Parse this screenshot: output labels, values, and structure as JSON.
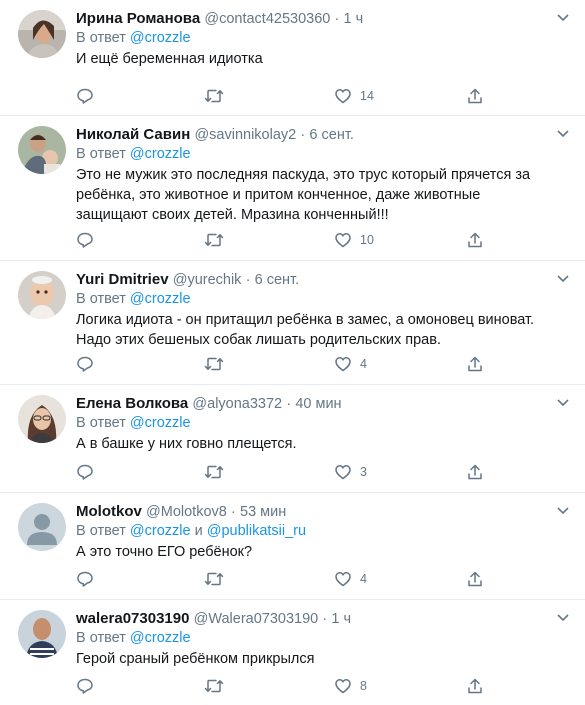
{
  "tweets": [
    {
      "name": "Ирина Романова",
      "handle": "@contact42530360",
      "sep": "·",
      "time": "1 ч",
      "reply_prefix": "В ответ",
      "reply_to": "@crozzle",
      "reply_and": "",
      "reply_to2": "",
      "text": "И ещё беременная идиотка",
      "likes": "14",
      "avatar_icon": "woman-photo-avatar"
    },
    {
      "name": "Николай Савин",
      "handle": "@savinnikolay2",
      "sep": "·",
      "time": "6 сент.",
      "reply_prefix": "В ответ",
      "reply_to": "@crozzle",
      "reply_and": "",
      "reply_to2": "",
      "text": "Это не мужик это последняя паскуда, это трус который прячется за ребёнка, это животное и притом конченное, даже животные защищают своих детей. Мразина конченный!!!",
      "likes": "10",
      "avatar_icon": "man-with-child-avatar"
    },
    {
      "name": "Yuri Dmitriev",
      "handle": "@yurechik",
      "sep": "·",
      "time": "6 сент.",
      "reply_prefix": "В ответ",
      "reply_to": "@crozzle",
      "reply_and": "",
      "reply_to2": "",
      "text": "Логика идиота - он притащил ребёнка в замес, а омоновец виноват. Надо этих бешеных собак лишать родительских прав.",
      "likes": "4",
      "avatar_icon": "baby-photo-avatar"
    },
    {
      "name": "Елена Волкова",
      "handle": "@alyona3372",
      "sep": "·",
      "time": "40 мин",
      "reply_prefix": "В ответ",
      "reply_to": "@crozzle",
      "reply_and": "",
      "reply_to2": "",
      "text": "А в башке у них говно плещется.",
      "likes": "3",
      "avatar_icon": "woman-glasses-avatar"
    },
    {
      "name": "Molotkov",
      "handle": "@Molotkov8",
      "sep": "·",
      "time": "53 мин",
      "reply_prefix": "В ответ",
      "reply_to": "@crozzle",
      "reply_and": "и",
      "reply_to2": "@publikatsii_ru",
      "text": "А это точно ЕГО ребёнок?",
      "likes": "4",
      "avatar_icon": "default-person-avatar"
    },
    {
      "name": "walera07303190",
      "handle": "@Walera07303190",
      "sep": "·",
      "time": "1 ч",
      "reply_prefix": "В ответ",
      "reply_to": "@crozzle",
      "reply_and": "",
      "reply_to2": "",
      "text": "Герой сраный ребёнком прикрылся",
      "likes": "8",
      "avatar_icon": "bald-man-avatar"
    }
  ],
  "colors": {
    "link": "#1b95e0",
    "secondary_text": "#657786",
    "divider": "#e6ecf0",
    "icon": "#657786"
  }
}
